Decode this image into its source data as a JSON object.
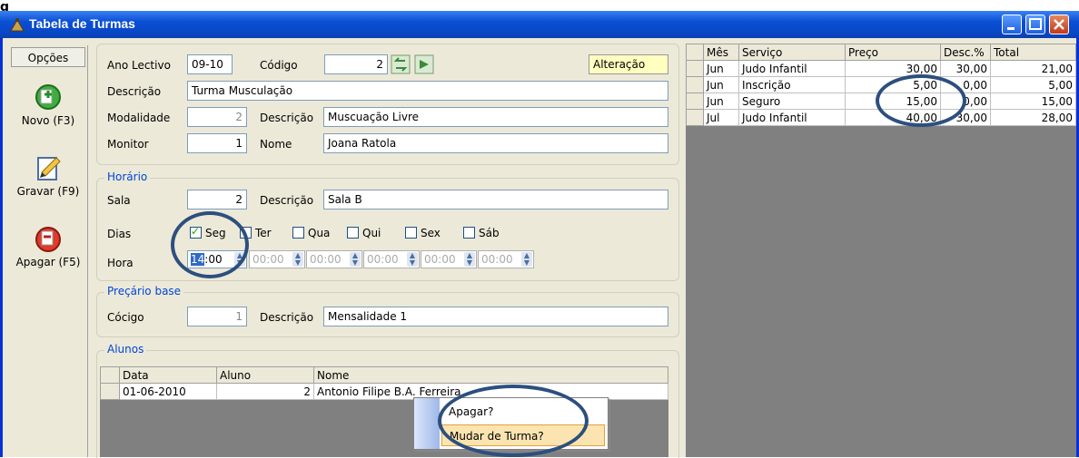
{
  "window": {
    "title": "Tabela de Turmas"
  },
  "sidebar": {
    "header": "Opções",
    "buttons": [
      {
        "label": "Novo (F3)",
        "icon": "add-icon"
      },
      {
        "label": "Gravar (F9)",
        "icon": "save-pencil-icon"
      },
      {
        "label": "Apagar (F5)",
        "icon": "delete-icon"
      }
    ]
  },
  "form": {
    "ano_lectivo_label": "Ano Lectivo",
    "ano_lectivo": "09-10",
    "codigo_label": "Código",
    "codigo": "2",
    "status": "Alteração",
    "descricao_label": "Descrição",
    "descricao": "Turma Musculação",
    "modalidade_label": "Modalidade",
    "modalidade": "2",
    "modalidade_desc_label": "Descrição",
    "modalidade_desc": "Muscuação Livre",
    "monitor_label": "Monitor",
    "monitor": "1",
    "nome_label": "Nome",
    "nome": "Joana Ratola"
  },
  "horario": {
    "title": "Horário",
    "sala_label": "Sala",
    "sala": "2",
    "sala_desc_label": "Descrição",
    "sala_desc": "Sala B",
    "dias_label": "Dias",
    "dias": [
      {
        "label": "Seg",
        "checked": true
      },
      {
        "label": "Ter",
        "checked": false
      },
      {
        "label": "Qua",
        "checked": false
      },
      {
        "label": "Qui",
        "checked": false
      },
      {
        "label": "Sex",
        "checked": false
      },
      {
        "label": "Sáb",
        "checked": false
      }
    ],
    "hora_label": "Hora",
    "hora_sel": "14",
    "hora_rest": ":00",
    "horas": [
      "00:00",
      "00:00",
      "00:00",
      "00:00",
      "00:00"
    ]
  },
  "preçario": {
    "title": "Preçário base",
    "codigo_label": "Cócigo",
    "codigo": "1",
    "desc_label": "Descrição",
    "desc": "Mensalidade 1"
  },
  "alunos": {
    "title": "Alunos",
    "columns": [
      "Data",
      "Aluno",
      "Nome"
    ],
    "rows": [
      {
        "data": "01-06-2010",
        "aluno": "2",
        "nome": "Antonio Filipe B.A. Ferreira"
      }
    ]
  },
  "context_menu": {
    "items": [
      "Apagar?",
      "Mudar de Turma?"
    ]
  },
  "services": {
    "columns": [
      "Mês",
      "Serviço",
      "Preço",
      "Desc.%",
      "Total"
    ],
    "rows": [
      {
        "mes": "Jun",
        "servico": "Judo Infantil",
        "preco": "30,00",
        "desc": "30,00",
        "total": "21,00"
      },
      {
        "mes": "Jun",
        "servico": "Inscrição",
        "preco": "5,00",
        "desc": "0,00",
        "total": "5,00"
      },
      {
        "mes": "Jun",
        "servico": "Seguro",
        "preco": "15,00",
        "desc": "0,00",
        "total": "15,00"
      },
      {
        "mes": "Jul",
        "servico": "Judo Infantil",
        "preco": "40,00",
        "desc": "30,00",
        "total": "28,00"
      }
    ]
  },
  "figure_label": "g"
}
